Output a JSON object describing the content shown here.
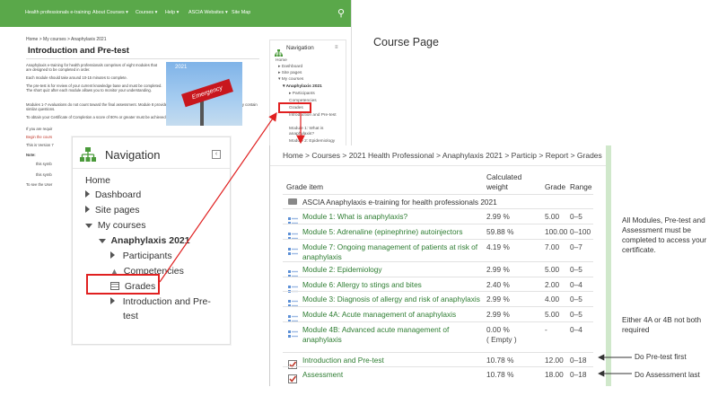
{
  "top_bar": {
    "items": [
      "Health professionals e-training",
      "About Courses ▾",
      "Courses ▾",
      "Help ▾",
      "ASCIA Websites ▾",
      "Site Map"
    ]
  },
  "small_page": {
    "breadcrumb": "Home  >  My courses  >  Anaphylaxis 2021",
    "title": "Introduction and Pre-test",
    "photo_year": "2021",
    "photo_sign": "Emergency",
    "paragraphs": [
      "Anaphylaxis e-training for health professionals comprises of eight modules that are designed to be completed in order.",
      "Each module should take around 10-15 minutes to complete.",
      "The pre-test is for review of your current knowledge base and must be completed. The short quiz after each module allows you to monitor your understanding.",
      "Modules 1-7 evaluations do not count toward the final assessment. Module 8 provides the overall course final assessment and may contain similar questions.",
      "To obtain your Certificate of Completion a score of 80% or greater must be achieved.",
      "If you are requir",
      "Begin the cours",
      "This is Version 7",
      "Note:",
      "this symb",
      "this symb",
      "To see the User"
    ],
    "nav": {
      "title": "Navigation",
      "items": [
        "Home",
        "Dashboard",
        "Site pages",
        "My courses",
        "Anaphylaxis 2021",
        "Participants",
        "Competencies",
        "Grades",
        "Introduction and Pre-test",
        "Module 1: What is anaphylaxis?",
        "Module 2: Epidemiology"
      ]
    }
  },
  "zoom_nav": {
    "title": "Navigation",
    "items": [
      "Home",
      "Dashboard",
      "Site pages",
      "My courses",
      "Anaphylaxis 2021",
      "Participants",
      "Competencies",
      "Grades",
      "Introduction and Pre-",
      "test"
    ]
  },
  "labels": {
    "course_page": "Course Page",
    "note_all": "All Modules, Pre-test and Assessment must be completed to access your certificate.",
    "note_either": "Either 4A or 4B not both required",
    "note_pretest": "Do Pre-test first",
    "note_assessment": "Do Assessment last"
  },
  "grades": {
    "breadcrumb": "Home  >  Courses  >  2021 Health Professional  >  Anaphylaxis 2021  >  Particip  >  Report  >  Grades",
    "headers": {
      "item": "Grade item",
      "weight": "Calculated weight",
      "grade": "Grade",
      "range": "Range"
    },
    "category": "ASCIA Anaphylaxis e-training for health professionals 2021",
    "rows": [
      {
        "name": "Module 1: What is anaphylaxis?",
        "weight": "2.99 %",
        "grade": "5.00",
        "range": "0–5",
        "icon": "quiz-icon"
      },
      {
        "name": "Module 5: Adrenaline (epinephrine) autoinjectors",
        "weight": "59.88 %",
        "grade": "100.00",
        "range": "0–100",
        "icon": "quiz-icon"
      },
      {
        "name": "Module 7: Ongoing management of patients at risk of anaphylaxis",
        "weight": "4.19 %",
        "grade": "7.00",
        "range": "0–7",
        "icon": "quiz-icon"
      },
      {
        "name": "Module 2: Epidemiology",
        "weight": "2.99 %",
        "grade": "5.00",
        "range": "0–5",
        "icon": "quiz-icon"
      },
      {
        "name": "Module 6: Allergy to stings and bites",
        "weight": "2.40 %",
        "grade": "2.00",
        "range": "0–4",
        "icon": "quiz-icon"
      },
      {
        "name": "Module 3: Diagnosis of allergy and risk of anaphylaxis",
        "weight": "2.99 %",
        "grade": "4.00",
        "range": "0–5",
        "icon": "quiz-icon"
      },
      {
        "name": "Module 4A: Acute management of anaphylaxis",
        "weight": "2.99 %",
        "grade": "5.00",
        "range": "0–5",
        "icon": "quiz-icon"
      },
      {
        "name": "Module 4B: Advanced acute management of anaphylaxis",
        "weight": "0.00 %",
        "weight2": "( Empty )",
        "grade": "-",
        "range": "0–4",
        "icon": "quiz-icon"
      },
      {
        "name": "Introduction and Pre-test",
        "weight": "10.78 %",
        "grade": "12.00",
        "range": "0–18",
        "icon": "checkbox-icon"
      },
      {
        "name": "Assessment",
        "weight": "10.78 %",
        "grade": "18.00",
        "range": "0–18",
        "icon": "checkbox-icon"
      }
    ]
  },
  "colors": {
    "moodle_green": "#5aa84a",
    "link_green": "#2e7d32",
    "highlight_red": "#e02020"
  }
}
